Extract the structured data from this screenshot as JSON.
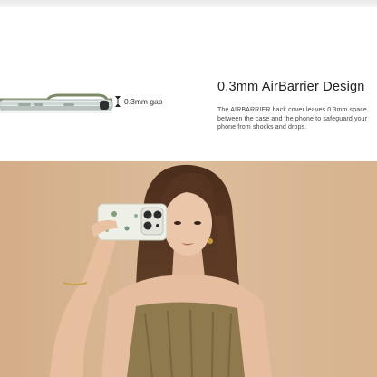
{
  "feature": {
    "gap_label": "0.3mm gap",
    "title": "0.3mm AirBarrier Design",
    "description": "The AIRBARRIER back cover leaves 0.3mm space between the case and the phone to safeguard your phone from shocks and drops."
  },
  "colors": {
    "background": "#ffffff",
    "case_frame": "#7d8a63",
    "photo_background": "#d8b694",
    "hair": "#5a3a24",
    "top_garment": "#8f7a4e"
  },
  "icons": [
    "gap-arrows-icon"
  ]
}
